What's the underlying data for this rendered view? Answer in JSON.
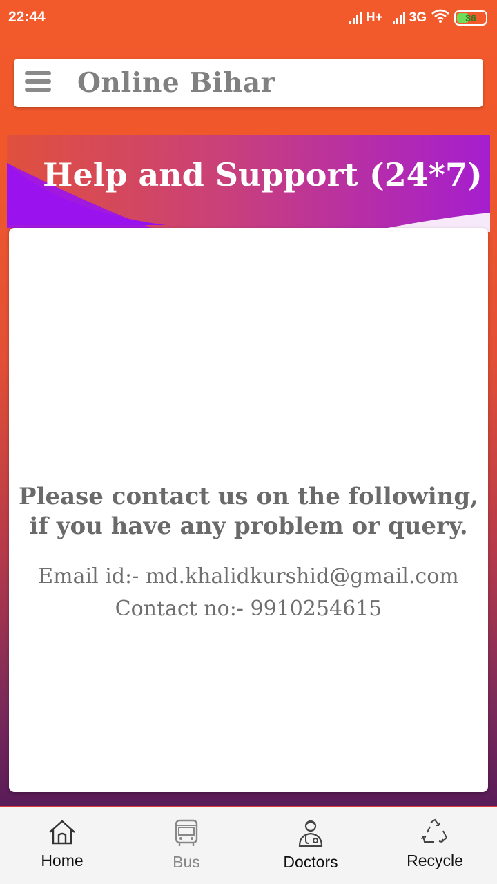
{
  "status_bar": {
    "time": "22:44",
    "network_1": "H+",
    "network_2": "3G",
    "battery": "36"
  },
  "app_bar": {
    "title": "Online Bihar"
  },
  "banner": {
    "title": "Help and Support (24*7)"
  },
  "card": {
    "heading_line1": "Please contact us on the following,",
    "heading_line2": "if you have any problem or query.",
    "email": "Email id:- md.khalidkurshid@gmail.com",
    "contact": "Contact no:- 9910254615"
  },
  "bottom_nav": {
    "items": [
      {
        "label": "Home",
        "icon": "home-icon"
      },
      {
        "label": "Bus",
        "icon": "bus-icon"
      },
      {
        "label": "Doctors",
        "icon": "doctor-icon"
      },
      {
        "label": "Recycle",
        "icon": "recycle-icon"
      }
    ]
  },
  "colors": {
    "status_bar": "#f25a2c",
    "banner_purple": "#9b1fe8",
    "banner_pink": "#c2378f",
    "title_gray": "#808080",
    "nav_border": "#e23a3a"
  }
}
